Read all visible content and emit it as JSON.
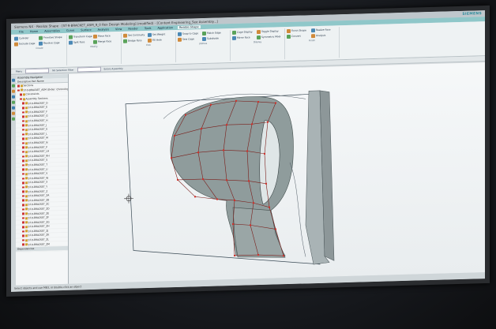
{
  "app": {
    "title": "Siemens NX - Realize Shape - [ST-9-BRACKET_ASM_9_0 Rex Design Modeling] (modified) - [Context Engineering_See Assembly...]",
    "brand": "SIEMENS"
  },
  "tabs": [
    "File",
    "Home",
    "Assemblies",
    "Curve",
    "Surface",
    "Analysis",
    "View",
    "Render",
    "Tools",
    "Application",
    "Realize Shape"
  ],
  "ribbon": {
    "groups": [
      {
        "label": "Create",
        "buttons": [
          "Cylinder",
          "Primitive Shape",
          "Extrude Cage",
          "Revolve Cage"
        ]
      },
      {
        "label": "Modify",
        "buttons": [
          "Transform Cage",
          "Move Face",
          "Split Face",
          "Merge Face"
        ]
      },
      {
        "label": "Edit",
        "buttons": [
          "Set Continuity",
          "Set Weight",
          "Bridge Face",
          "Fill Hole"
        ]
      },
      {
        "label": "Utilities",
        "buttons": [
          "Snap to Cage",
          "Match Edge",
          "Sew Cage",
          "Subdivide"
        ]
      },
      {
        "label": "Display",
        "buttons": [
          "Cage Display",
          "Toggle Display",
          "Mirror Face",
          "Symmetric Modeling"
        ]
      },
      {
        "label": "Finish",
        "buttons": [
          "Finish Shape",
          "Realize Face",
          "Convert",
          "Analysis"
        ]
      }
    ]
  },
  "cmdbar": {
    "menu": "Menu",
    "filter": "No Selection Filter",
    "scope": "Entire Assembly"
  },
  "navigator": {
    "title": "Assembly Navigator",
    "col_name": "Descriptive Part Name",
    "col_status": "",
    "items": [
      "Sections",
      "ST-9-BRACKET_ASM (Order: Chronological)",
      "Constraints",
      "Assembly Sections",
      "ST-9-BRACKET_D",
      "ST-9-BRACKET_E",
      "ST-9-BRACKET_F",
      "ST-9-BRACKET_G",
      "ST-9-BRACKET_H",
      "ST-9-BRACKET_J",
      "ST-9-BRACKET_K",
      "ST-9-BRACKET_L",
      "ST-9-BRACKET_M",
      "ST-9-BRACKET_N",
      "ST-9-BRACKET_P",
      "ST-9-BRACKET_LH",
      "ST-9-BRACKET_RH",
      "ST-9-BRACKET_S",
      "ST-9-BRACKET_T",
      "ST-9-BRACKET_U",
      "ST-9-BRACKET_V",
      "ST-9-BRACKET_W",
      "ST-9-BRACKET_X",
      "ST-9-BRACKET_Y",
      "ST-9-BRACKET_Z",
      "ST-9-BRACKET_ZA",
      "ST-9-BRACKET_ZB",
      "ST-9-BRACKET_ZC",
      "ST-9-BRACKET_ZD",
      "ST-9-BRACKET_ZE",
      "ST-9-BRACKET_ZF",
      "ST-9-BRACKET_ZG",
      "ST-9-BRACKET_ZH",
      "ST-9-BRACKET_ZJ",
      "ST-9-BRACKET_ZK",
      "ST-9-BRACKET_ZL",
      "ST-9-BRACKET_ZM"
    ],
    "footer": "Dependencies"
  },
  "status": {
    "text": "Select objects and use MB3, or double-click an object"
  },
  "colors": {
    "ribbon_tab": "#8fc7c9",
    "cage_vertex": "#d0302a",
    "surface": "#8f9c9c"
  }
}
